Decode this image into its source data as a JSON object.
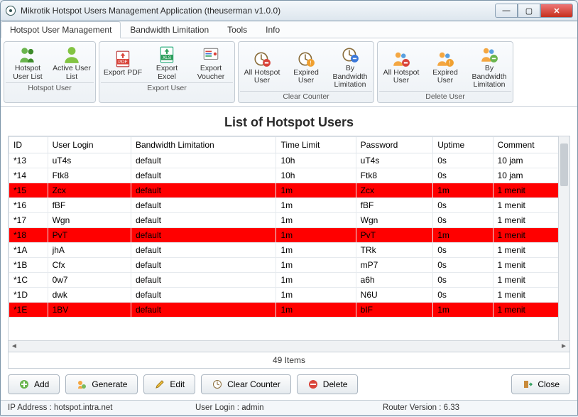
{
  "window": {
    "title": "Mikrotik Hotspot Users Management Application (theuserman v1.0.0)"
  },
  "tabs": [
    "Hotspot User Management",
    "Bandwidth Limitation",
    "Tools",
    "Info"
  ],
  "ribbon": {
    "groups": [
      {
        "title": "Hotspot User",
        "items": [
          {
            "label": "Hotspot User List"
          },
          {
            "label": "Active User List"
          }
        ]
      },
      {
        "title": "Export User",
        "items": [
          {
            "label": "Export PDF"
          },
          {
            "label": "Export Excel"
          },
          {
            "label": "Export Voucher"
          }
        ]
      },
      {
        "title": "Clear Counter",
        "items": [
          {
            "label": "All Hotspot User"
          },
          {
            "label": "Expired User"
          },
          {
            "label": "By Bandwidth Limitation"
          }
        ]
      },
      {
        "title": "Delete User",
        "items": [
          {
            "label": "All Hotspot User"
          },
          {
            "label": "Expired User"
          },
          {
            "label": "By Bandwidth Limitation"
          }
        ]
      }
    ]
  },
  "list": {
    "title": "List of Hotspot Users",
    "count_label": "49 Items",
    "columns": [
      "ID",
      "User Login",
      "Bandwidth Limitation",
      "Time Limit",
      "Password",
      "Uptime",
      "Comment"
    ],
    "rows": [
      {
        "red": false,
        "cells": [
          "*13",
          "uT4s",
          "default",
          "10h",
          "uT4s",
          "0s",
          "10 jam"
        ]
      },
      {
        "red": false,
        "cells": [
          "*14",
          "Ftk8",
          "default",
          "10h",
          "Ftk8",
          "0s",
          "10 jam"
        ]
      },
      {
        "red": true,
        "cells": [
          "*15",
          "Zcx",
          "default",
          "1m",
          "Zcx",
          "1m",
          "1 menit"
        ]
      },
      {
        "red": false,
        "cells": [
          "*16",
          "fBF",
          "default",
          "1m",
          "fBF",
          "0s",
          "1 menit"
        ]
      },
      {
        "red": false,
        "cells": [
          "*17",
          "Wgn",
          "default",
          "1m",
          "Wgn",
          "0s",
          "1 menit"
        ]
      },
      {
        "red": true,
        "cells": [
          "*18",
          "PvT",
          "default",
          "1m",
          "PvT",
          "1m",
          "1 menit"
        ]
      },
      {
        "red": false,
        "cells": [
          "*1A",
          "jhA",
          "default",
          "1m",
          "TRk",
          "0s",
          "1 menit"
        ]
      },
      {
        "red": false,
        "cells": [
          "*1B",
          "Cfx",
          "default",
          "1m",
          "mP7",
          "0s",
          "1 menit"
        ]
      },
      {
        "red": false,
        "cells": [
          "*1C",
          "0w7",
          "default",
          "1m",
          "a6h",
          "0s",
          "1 menit"
        ]
      },
      {
        "red": false,
        "cells": [
          "*1D",
          "dwk",
          "default",
          "1m",
          "N6U",
          "0s",
          "1 menit"
        ]
      },
      {
        "red": true,
        "cells": [
          "*1E",
          "1BV",
          "default",
          "1m",
          "bIF",
          "1m",
          "1 menit"
        ]
      }
    ]
  },
  "buttons": {
    "add": "Add",
    "generate": "Generate",
    "edit": "Edit",
    "clear": "Clear Counter",
    "delete": "Delete",
    "close": "Close"
  },
  "status": {
    "ip": "IP Address : hotspot.intra.net",
    "user": "User Login : admin",
    "router": "Router Version : 6.33"
  }
}
